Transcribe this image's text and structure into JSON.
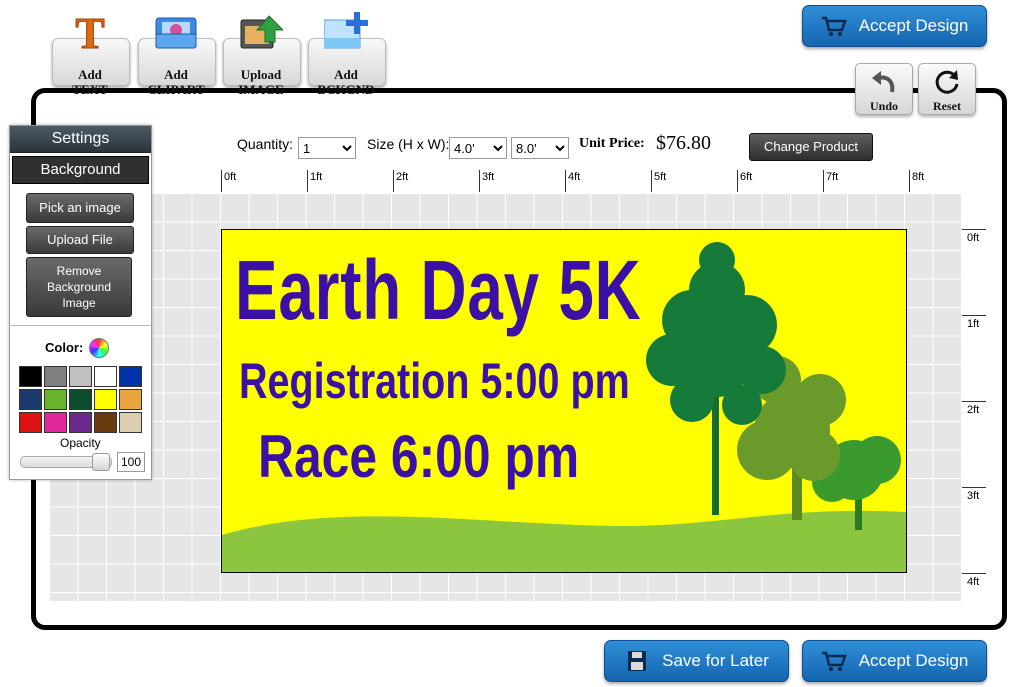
{
  "toolbar": {
    "add_text": "Add\nTEXT",
    "add_clipart": "Add\nCLIPART",
    "upload_image": "Upload\nIMAGE",
    "add_background": "Add\nBCKGND"
  },
  "actions": {
    "accept_design": "Accept Design",
    "save_for_later": "Save for Later",
    "undo": "Undo",
    "reset": "Reset"
  },
  "product": {
    "quantity_label": "Quantity:",
    "quantity_value": "1",
    "size_label": "Size (H x W):",
    "height_value": "4.0'",
    "width_value": "8.0'",
    "unit_price_label": "Unit Price:",
    "unit_price": "$76.80",
    "change_product": "Change Product"
  },
  "ruler": {
    "horizontal": [
      "0ft",
      "1ft",
      "2ft",
      "3ft",
      "4ft",
      "5ft",
      "6ft",
      "7ft",
      "8ft"
    ],
    "vertical": [
      "0ft",
      "1ft",
      "2ft",
      "3ft",
      "4ft"
    ]
  },
  "design": {
    "line1": "Earth Day 5K",
    "line2": "Registration 5:00 pm",
    "line3": "Race 6:00 pm",
    "background_color": "#ffff00",
    "text_color": "#3b10a6",
    "grass_color": "#8cc63f"
  },
  "settings": {
    "title": "Settings",
    "section": "Background",
    "pick_image": "Pick an image",
    "upload_file": "Upload File",
    "remove_background": "Remove\nBackground\nImage",
    "color_label": "Color:",
    "opacity_label": "Opacity",
    "opacity_value": "100",
    "swatches": [
      "#000000",
      "#808080",
      "#c0c0c0",
      "#ffffff",
      "#0033aa",
      "#1a3a6b",
      "#6ab42d",
      "#0b4d2c",
      "#ffff00",
      "#e8a540",
      "#dd1111",
      "#e0289a",
      "#6a2a8c",
      "#6b3b10",
      "#dccfb0"
    ]
  }
}
